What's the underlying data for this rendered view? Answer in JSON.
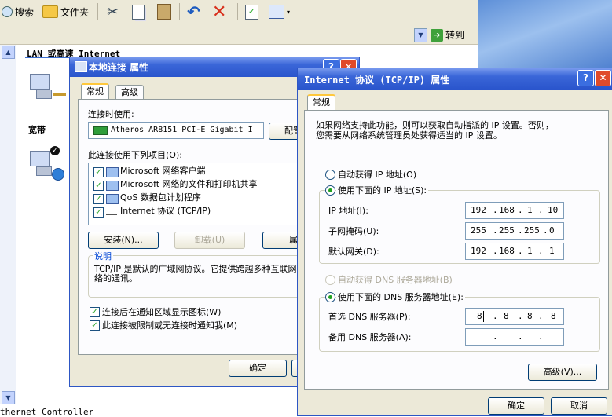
{
  "explorer": {
    "toolbar": {
      "search_label": "搜索",
      "folders_label": "文件夹"
    },
    "go_label": "转到",
    "lan_header": "LAN 或高速 Internet",
    "broadband_header": "宽带",
    "status_text": "thernet Controller"
  },
  "dialog1": {
    "title": "本地连接 属性",
    "tabs": [
      "常规",
      "高级"
    ],
    "connect_using_label": "连接时使用:",
    "adapter_name": "Atheros AR8151 PCI-E Gigabit I",
    "configure_label": "配置",
    "items_label": "此连接使用下列项目(O):",
    "items": [
      {
        "label": "Microsoft 网络客户端",
        "checked": true
      },
      {
        "label": "Microsoft 网络的文件和打印机共享",
        "checked": true
      },
      {
        "label": "QoS 数据包计划程序",
        "checked": true
      },
      {
        "label": "Internet 协议 (TCP/IP)",
        "checked": true
      }
    ],
    "install_label": "安装(N)...",
    "uninstall_label": "卸载(U)",
    "properties_label": "属性",
    "description_header": "说明",
    "description_text": "TCP/IP 是默认的广域网协议。它提供跨越多种互联网络的通讯。",
    "show_icon_label": "连接后在通知区域显示图标(W)",
    "notify_label": "此连接被限制或无连接时通知我(M)",
    "show_icon_checked": true,
    "notify_checked": true,
    "ok_label": "确定"
  },
  "dialog2": {
    "title": "Internet 协议 (TCP/IP) 属性",
    "help_label": "?",
    "tab": "常规",
    "intro_line1": "如果网络支持此功能，则可以获取自动指派的 IP 设置。否则，",
    "intro_line2": "您需要从网络系统管理员处获得适当的 IP 设置。",
    "auto_ip_label": "自动获得 IP 地址(O)",
    "use_ip_label": "使用下面的 IP 地址(S):",
    "ip_label": "IP 地址(I):",
    "ip_value": [
      "192",
      "168",
      "1",
      "10"
    ],
    "mask_label": "子网掩码(U):",
    "mask_value": [
      "255",
      "255",
      "255",
      "0"
    ],
    "gateway_label": "默认网关(D):",
    "gateway_value": [
      "192",
      "168",
      "1",
      "1"
    ],
    "auto_dns_label": "自动获得 DNS 服务器地址(B)",
    "use_dns_label": "使用下面的 DNS 服务器地址(E):",
    "pref_dns_label": "首选 DNS 服务器(P):",
    "pref_dns_value": [
      "8",
      "8",
      "8",
      "8"
    ],
    "alt_dns_label": "备用 DNS 服务器(A):",
    "alt_dns_value": [
      "",
      "",
      "",
      ""
    ],
    "advanced_label": "高级(V)...",
    "ok_label": "确定",
    "cancel_label": "取消",
    "selected_ip_mode": "manual",
    "selected_dns_mode": "manual"
  },
  "colors": {
    "titlebar": "#2a55cc",
    "dialog_bg": "#ece9d8",
    "close_red": "#e04a2a",
    "checkmark_green": "#21a121",
    "tab_highlight": "#ffc83c"
  }
}
